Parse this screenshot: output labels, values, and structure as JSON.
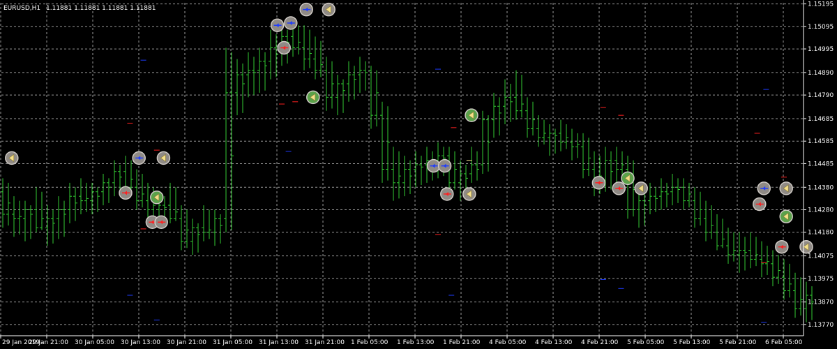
{
  "header": {
    "symbol_text": "EURUSD,H1",
    "ohlc_text": "1.11881 1.11881 1.11881 1.11881"
  },
  "colors": {
    "background": "#000000",
    "grid": "#9a9a9a",
    "bars": "#33cc33",
    "axis": "#ffffff",
    "text": "#ffffff",
    "marker_fill": "#8f8a85",
    "marker_outline": "#cfcac5",
    "buy": "#1e3cff",
    "sell": "#ff2020",
    "close": "#f5e08a"
  },
  "chart_data": {
    "type": "ohlc",
    "symbol": "EURUSD",
    "timeframe": "H1",
    "grid": true,
    "ylim": [
      1.1372,
      1.152
    ],
    "y_ticks": [
      "1.15195",
      "1.15095",
      "1.14995",
      "1.14890",
      "1.14790",
      "1.14685",
      "1.14585",
      "1.14485",
      "1.14380",
      "1.14280",
      "1.14180",
      "1.14075",
      "1.13975",
      "1.13870",
      "1.13770"
    ],
    "x_ticks": [
      "29 Jan 2019",
      "29 Jan 21:00",
      "30 Jan 05:00",
      "30 Jan 13:00",
      "30 Jan 21:00",
      "31 Jan 05:00",
      "31 Jan 13:00",
      "31 Jan 21:00",
      "1 Feb 05:00",
      "1 Feb 13:00",
      "1 Feb 21:00",
      "4 Feb 05:00",
      "4 Feb 13:00",
      "4 Feb 21:00",
      "5 Feb 05:00",
      "5 Feb 13:00",
      "5 Feb 21:00",
      "6 Feb 05:00"
    ],
    "bars": [
      [
        0,
        1.1436,
        1.1442,
        1.142,
        1.1426
      ],
      [
        1,
        1.1426,
        1.1434,
        1.1416,
        1.1424
      ],
      [
        2,
        1.1424,
        1.1432,
        1.1414,
        1.1428
      ],
      [
        3,
        1.1428,
        1.1438,
        1.1418,
        1.142
      ],
      [
        4,
        1.142,
        1.143,
        1.1412,
        1.1424
      ],
      [
        5,
        1.1424,
        1.1434,
        1.1415,
        1.1428
      ],
      [
        6,
        1.1428,
        1.144,
        1.1422,
        1.1434
      ],
      [
        7,
        1.1434,
        1.1442,
        1.1426,
        1.1432
      ],
      [
        8,
        1.1432,
        1.144,
        1.1426,
        1.1436
      ],
      [
        9,
        1.1436,
        1.1444,
        1.143,
        1.144
      ],
      [
        10,
        1.144,
        1.145,
        1.1434,
        1.1445
      ],
      [
        11,
        1.1445,
        1.1452,
        1.1436,
        1.1438
      ],
      [
        12,
        1.1438,
        1.1446,
        1.1428,
        1.1432
      ],
      [
        13,
        1.1432,
        1.144,
        1.1424,
        1.1428
      ],
      [
        14,
        1.1428,
        1.1436,
        1.142,
        1.143
      ],
      [
        15,
        1.143,
        1.144,
        1.1422,
        1.1424
      ],
      [
        16,
        1.1424,
        1.143,
        1.141,
        1.1414
      ],
      [
        17,
        1.1414,
        1.1424,
        1.1408,
        1.142
      ],
      [
        18,
        1.142,
        1.143,
        1.1414,
        1.1418
      ],
      [
        19,
        1.1418,
        1.1428,
        1.1412,
        1.1424
      ],
      [
        20,
        1.1424,
        1.15,
        1.1418,
        1.148
      ],
      [
        21,
        1.148,
        1.1495,
        1.147,
        1.1488
      ],
      [
        22,
        1.1488,
        1.1498,
        1.1478,
        1.149
      ],
      [
        23,
        1.149,
        1.15,
        1.148,
        1.1494
      ],
      [
        24,
        1.1494,
        1.1508,
        1.1486,
        1.15
      ],
      [
        25,
        1.15,
        1.151,
        1.1492,
        1.1505
      ],
      [
        26,
        1.1505,
        1.1512,
        1.1496,
        1.15
      ],
      [
        27,
        1.15,
        1.151,
        1.149,
        1.1495
      ],
      [
        28,
        1.1495,
        1.1505,
        1.1486,
        1.149
      ],
      [
        29,
        1.149,
        1.1496,
        1.1472,
        1.1478
      ],
      [
        30,
        1.1478,
        1.1488,
        1.147,
        1.1484
      ],
      [
        31,
        1.1484,
        1.1494,
        1.1476,
        1.1488
      ],
      [
        32,
        1.1488,
        1.1496,
        1.148,
        1.149
      ],
      [
        33,
        1.149,
        1.1492,
        1.1464,
        1.147
      ],
      [
        34,
        1.147,
        1.1476,
        1.144,
        1.1446
      ],
      [
        35,
        1.1446,
        1.1456,
        1.1432,
        1.144
      ],
      [
        36,
        1.144,
        1.1452,
        1.1434,
        1.1446
      ],
      [
        37,
        1.1446,
        1.1454,
        1.1438,
        1.1448
      ],
      [
        38,
        1.1448,
        1.1456,
        1.144,
        1.145
      ],
      [
        39,
        1.145,
        1.1458,
        1.1442,
        1.1452
      ],
      [
        40,
        1.1452,
        1.1456,
        1.1436,
        1.144
      ],
      [
        41,
        1.144,
        1.145,
        1.1432,
        1.1444
      ],
      [
        42,
        1.1444,
        1.1456,
        1.144,
        1.1448
      ],
      [
        43,
        1.1448,
        1.1472,
        1.1444,
        1.1468
      ],
      [
        44,
        1.1468,
        1.148,
        1.146,
        1.1474
      ],
      [
        45,
        1.1474,
        1.1486,
        1.1466,
        1.1478
      ],
      [
        46,
        1.1478,
        1.149,
        1.1468,
        1.1472
      ],
      [
        47,
        1.1472,
        1.1478,
        1.146,
        1.1464
      ],
      [
        48,
        1.1464,
        1.147,
        1.1456,
        1.146
      ],
      [
        49,
        1.146,
        1.1466,
        1.1452,
        1.1462
      ],
      [
        50,
        1.1462,
        1.1468,
        1.1454,
        1.1458
      ],
      [
        51,
        1.1458,
        1.1464,
        1.145,
        1.1456
      ],
      [
        52,
        1.1456,
        1.1462,
        1.1442,
        1.1446
      ],
      [
        53,
        1.1446,
        1.1454,
        1.1434,
        1.144
      ],
      [
        54,
        1.144,
        1.1456,
        1.1436,
        1.145
      ],
      [
        55,
        1.145,
        1.1456,
        1.144,
        1.1446
      ],
      [
        56,
        1.1446,
        1.1452,
        1.1424,
        1.1428
      ],
      [
        57,
        1.1428,
        1.1438,
        1.142,
        1.1432
      ],
      [
        58,
        1.1432,
        1.144,
        1.1426,
        1.1434
      ],
      [
        59,
        1.1434,
        1.1442,
        1.1428,
        1.1436
      ],
      [
        60,
        1.1436,
        1.1444,
        1.143,
        1.1438
      ],
      [
        61,
        1.1438,
        1.1442,
        1.1428,
        1.1432
      ],
      [
        62,
        1.1432,
        1.1438,
        1.142,
        1.1424
      ],
      [
        63,
        1.1424,
        1.1432,
        1.1414,
        1.1418
      ],
      [
        64,
        1.1418,
        1.1426,
        1.141,
        1.1412
      ],
      [
        65,
        1.1412,
        1.142,
        1.1404,
        1.1408
      ],
      [
        66,
        1.1408,
        1.1418,
        1.14,
        1.141
      ],
      [
        67,
        1.141,
        1.1418,
        1.1402,
        1.1406
      ],
      [
        68,
        1.1406,
        1.1414,
        1.1398,
        1.1404
      ],
      [
        69,
        1.1404,
        1.141,
        1.1394,
        1.1398
      ],
      [
        70,
        1.1398,
        1.1406,
        1.1388,
        1.1392
      ],
      [
        71,
        1.1392,
        1.14,
        1.138,
        1.1384
      ],
      [
        72,
        1.1384,
        1.1396,
        1.1378,
        1.139
      ]
    ],
    "markers": [
      {
        "time": 0.4,
        "price": 1.1451,
        "kind": "close"
      },
      {
        "time": 6.1,
        "price": 1.1451,
        "kind": "buy"
      },
      {
        "time": 7.2,
        "price": 1.1451,
        "kind": "close"
      },
      {
        "time": 5.5,
        "price": 1.14355,
        "kind": "sell"
      },
      {
        "time": 6.9,
        "price": 1.14335,
        "kind": "close_green"
      },
      {
        "time": 6.7,
        "price": 1.14225,
        "kind": "sell"
      },
      {
        "time": 7.1,
        "price": 1.14225,
        "kind": "sell"
      },
      {
        "time": 12.3,
        "price": 1.151,
        "kind": "buy"
      },
      {
        "time": 12.9,
        "price": 1.1511,
        "kind": "buy"
      },
      {
        "time": 13.6,
        "price": 1.1517,
        "kind": "buy"
      },
      {
        "time": 14.6,
        "price": 1.1517,
        "kind": "close"
      },
      {
        "time": 12.6,
        "price": 1.15,
        "kind": "sell"
      },
      {
        "time": 13.9,
        "price": 1.1478,
        "kind": "close_green"
      },
      {
        "time": 19.3,
        "price": 1.14475,
        "kind": "buy"
      },
      {
        "time": 19.8,
        "price": 1.14475,
        "kind": "buy"
      },
      {
        "time": 21.0,
        "price": 1.147,
        "kind": "close_green"
      },
      {
        "time": 19.9,
        "price": 1.1435,
        "kind": "sell"
      },
      {
        "time": 20.9,
        "price": 1.1435,
        "kind": "close"
      },
      {
        "time": 26.7,
        "price": 1.144,
        "kind": "sell"
      },
      {
        "time": 27.6,
        "price": 1.14375,
        "kind": "sell"
      },
      {
        "time": 28.6,
        "price": 1.14375,
        "kind": "close"
      },
      {
        "time": 28.0,
        "price": 1.1442,
        "kind": "close_green"
      },
      {
        "time": 33.9,
        "price": 1.14305,
        "kind": "sell"
      },
      {
        "time": 34.1,
        "price": 1.14375,
        "kind": "buy"
      },
      {
        "time": 35.1,
        "price": 1.14375,
        "kind": "close"
      },
      {
        "time": 35.1,
        "price": 1.1425,
        "kind": "close_green"
      },
      {
        "time": 34.9,
        "price": 1.14115,
        "kind": "sell"
      },
      {
        "time": 36.0,
        "price": 1.14115,
        "kind": "close"
      },
      {
        "time": 41.1,
        "price": 1.1403,
        "kind": "buy"
      },
      {
        "time": 42.2,
        "price": 1.1403,
        "kind": "close"
      },
      {
        "time": 41.6,
        "price": 1.1378,
        "kind": "sell"
      }
    ],
    "dashes": [
      {
        "time": 0.5,
        "price": 1.14505,
        "kind": "buy"
      },
      {
        "time": 5.7,
        "price": 1.14665,
        "kind": "sell"
      },
      {
        "time": 6.9,
        "price": 1.14545,
        "kind": "sell"
      },
      {
        "time": 6.3,
        "price": 1.14195,
        "kind": "sell"
      },
      {
        "time": 6.3,
        "price": 1.14945,
        "kind": "buy"
      },
      {
        "time": 5.7,
        "price": 1.139,
        "kind": "buy"
      },
      {
        "time": 6.9,
        "price": 1.1379,
        "kind": "buy"
      },
      {
        "time": 12.5,
        "price": 1.1475,
        "kind": "sell"
      },
      {
        "time": 13.1,
        "price": 1.1476,
        "kind": "sell"
      },
      {
        "time": 12.8,
        "price": 1.1454,
        "kind": "buy"
      },
      {
        "time": 19.5,
        "price": 1.14905,
        "kind": "buy"
      },
      {
        "time": 20.2,
        "price": 1.14645,
        "kind": "sell"
      },
      {
        "time": 20.9,
        "price": 1.145,
        "kind": "close"
      },
      {
        "time": 19.5,
        "price": 1.1417,
        "kind": "sell"
      },
      {
        "time": 20.1,
        "price": 1.139,
        "kind": "buy"
      },
      {
        "time": 26.9,
        "price": 1.14735,
        "kind": "sell"
      },
      {
        "time": 27.7,
        "price": 1.147,
        "kind": "sell"
      },
      {
        "time": 26.9,
        "price": 1.1397,
        "kind": "buy"
      },
      {
        "time": 27.7,
        "price": 1.1393,
        "kind": "buy"
      },
      {
        "time": 34.2,
        "price": 1.14815,
        "kind": "buy"
      },
      {
        "time": 33.8,
        "price": 1.1462,
        "kind": "sell"
      },
      {
        "time": 35.0,
        "price": 1.14425,
        "kind": "sell"
      },
      {
        "time": 34.1,
        "price": 1.14045,
        "kind": "sell"
      },
      {
        "time": 34.1,
        "price": 1.1378,
        "kind": "buy"
      },
      {
        "time": 41.2,
        "price": 1.1448,
        "kind": "buy"
      },
      {
        "time": 41.7,
        "price": 1.1413,
        "kind": "sell"
      }
    ]
  }
}
